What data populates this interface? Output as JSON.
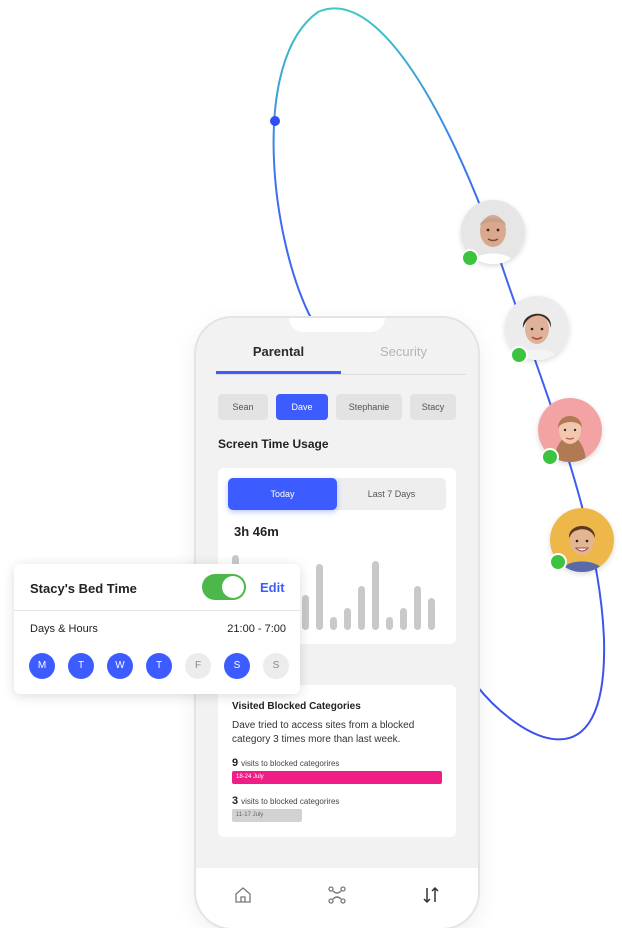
{
  "colors": {
    "accent": "#3d5cff",
    "toggle_on": "#4cb849",
    "online": "#3cc33f",
    "blocked_bar": "#f01d85",
    "bar_grey": "#c9c9c9"
  },
  "avatars": [
    {
      "name_icon": "avatar-bald-man",
      "online": true
    },
    {
      "name_icon": "avatar-woman-short-hair",
      "online": true
    },
    {
      "name_icon": "avatar-girl",
      "online": true
    },
    {
      "name_icon": "avatar-boy",
      "online": true
    }
  ],
  "tabs": [
    {
      "label": "Parental",
      "active": true
    },
    {
      "label": "Security",
      "active": false
    }
  ],
  "kids": [
    {
      "label": "Sean",
      "active": false
    },
    {
      "label": "Dave",
      "active": true
    },
    {
      "label": "Stephanie",
      "active": false
    },
    {
      "label": "Stacy",
      "active": false
    }
  ],
  "screen_time": {
    "title": "Screen Time Usage",
    "ranges": [
      {
        "label": "Today",
        "active": true
      },
      {
        "label": "Last 7 Days",
        "active": false
      }
    ],
    "total": "3h 46m",
    "bar_levels": [
      0.85,
      0.2,
      0.35,
      0.55,
      0.25,
      0.4,
      0.75,
      0.15,
      0.25,
      0.5,
      0.78,
      0.15,
      0.25,
      0.5,
      0.36
    ]
  },
  "blocked": {
    "title": "Visited Blocked Categories",
    "description": "Dave tried to access sites from a blocked category 3 times more than last week.",
    "rows": [
      {
        "count": "9",
        "text": "visits to blocked categorires",
        "period": "18-24 July",
        "style": "pink"
      },
      {
        "count": "3",
        "text": "visits to blocked categorires",
        "period": "11-17 July",
        "style": "grey"
      }
    ]
  },
  "nav": [
    {
      "icon": "home-icon"
    },
    {
      "icon": "scan-icon"
    },
    {
      "icon": "sort-arrows-icon"
    }
  ],
  "bedtime": {
    "title": "Stacy's Bed Time",
    "enabled": true,
    "edit_label": "Edit",
    "days_label": "Days & Hours",
    "time_range": "21:00 - 7:00",
    "days": [
      {
        "label": "M",
        "on": true
      },
      {
        "label": "T",
        "on": true
      },
      {
        "label": "W",
        "on": true
      },
      {
        "label": "T",
        "on": true
      },
      {
        "label": "F",
        "on": false
      },
      {
        "label": "S",
        "on": true
      },
      {
        "label": "S",
        "on": false
      }
    ]
  }
}
